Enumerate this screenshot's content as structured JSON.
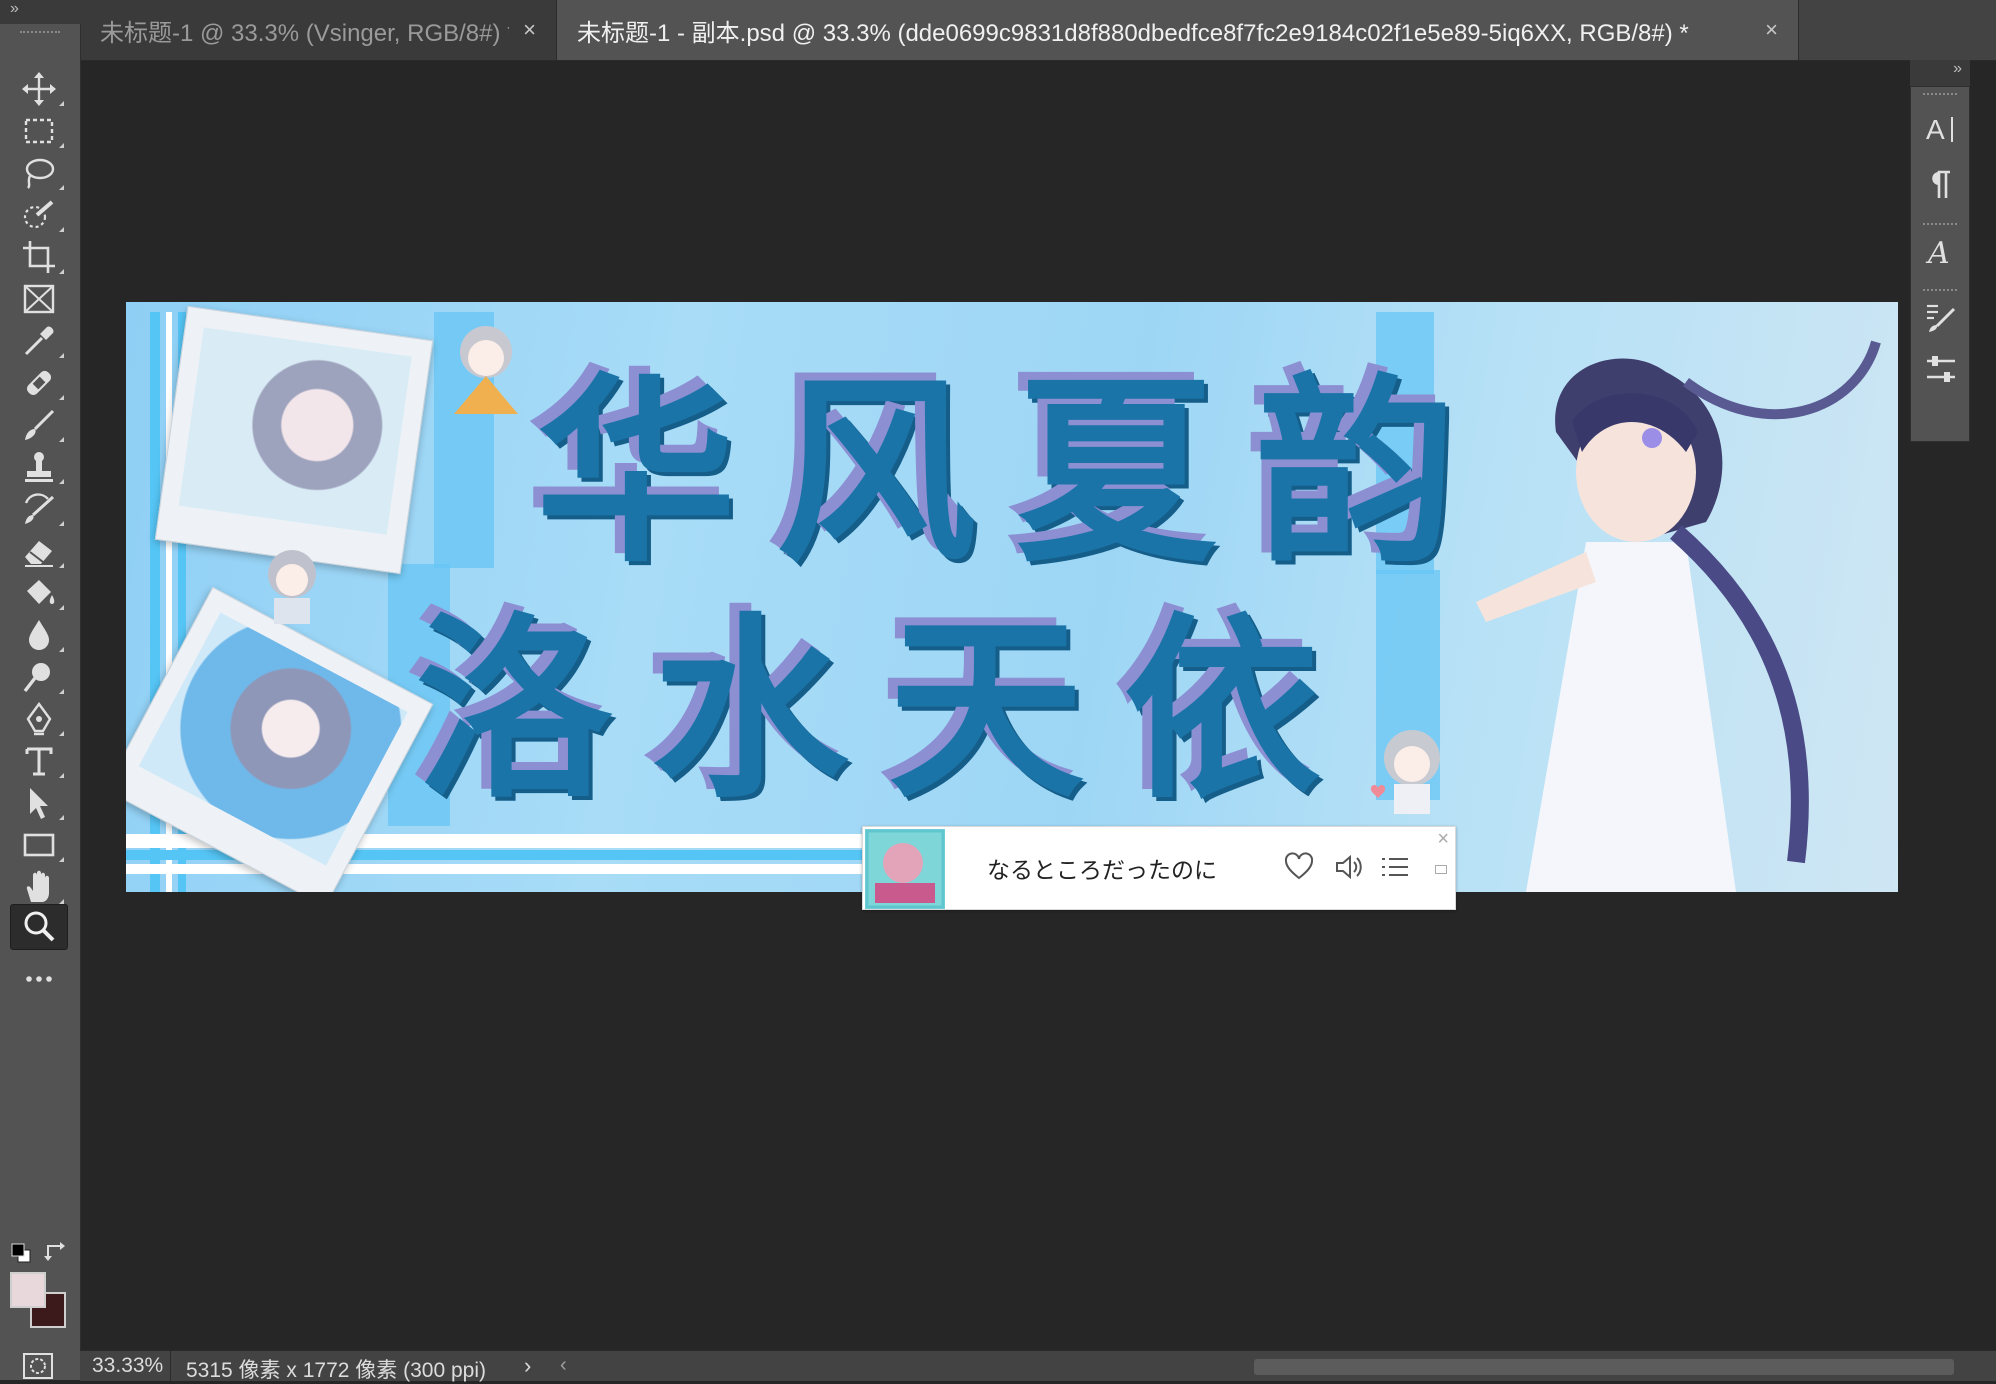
{
  "tabs": [
    {
      "title": "未标题-1 @ 33.3% (Vsinger, RGB/8#) *",
      "close": "×",
      "active": false
    },
    {
      "title": "未标题-1 - 副本.psd @ 33.3% (dde0699c9831d8f880dbedfce8f7fc2e9184c02f1e5e89-5iq6XX, RGB/8#) *",
      "close": "×",
      "active": true
    }
  ],
  "collapse_glyph": "»",
  "tools": [
    {
      "name": "move-tool",
      "icon": "move-icon"
    },
    {
      "name": "marquee-tool",
      "icon": "rect-marquee-icon"
    },
    {
      "name": "lasso-tool",
      "icon": "lasso-icon"
    },
    {
      "name": "quick-select-tool",
      "icon": "quick-select-icon"
    },
    {
      "name": "crop-tool",
      "icon": "crop-icon"
    },
    {
      "name": "frame-tool",
      "icon": "frame-icon"
    },
    {
      "name": "eyedropper-tool",
      "icon": "eyedropper-icon"
    },
    {
      "name": "healing-brush-tool",
      "icon": "bandage-icon"
    },
    {
      "name": "brush-tool",
      "icon": "brush-icon"
    },
    {
      "name": "clone-stamp-tool",
      "icon": "stamp-icon"
    },
    {
      "name": "history-brush-tool",
      "icon": "history-brush-icon"
    },
    {
      "name": "eraser-tool",
      "icon": "eraser-icon"
    },
    {
      "name": "paint-bucket-tool",
      "icon": "bucket-icon"
    },
    {
      "name": "blur-tool",
      "icon": "drop-icon"
    },
    {
      "name": "dodge-tool",
      "icon": "dodge-icon"
    },
    {
      "name": "pen-tool",
      "icon": "pen-icon"
    },
    {
      "name": "type-tool",
      "icon": "type-icon"
    },
    {
      "name": "path-select-tool",
      "icon": "arrow-icon"
    },
    {
      "name": "rectangle-tool",
      "icon": "rectangle-icon"
    },
    {
      "name": "hand-tool",
      "icon": "hand-icon"
    },
    {
      "name": "zoom-tool",
      "icon": "zoom-icon",
      "selected": true
    },
    {
      "name": "more-tools",
      "icon": "ellipsis-icon"
    }
  ],
  "colors": {
    "foreground": "#e8d8dc",
    "background": "#3c1a1c",
    "canvas_bg": "#262626",
    "panel_bg": "#535353"
  },
  "right_panel": [
    "character-panel-icon",
    "paragraph-panel-icon",
    "glyphs-panel-icon",
    "brush-settings-icon",
    "tool-presets-icon"
  ],
  "canvas": {
    "line1": "华风夏韵",
    "line2": "洛水天依"
  },
  "player": {
    "lyric": "なるところだったのに",
    "close": "×",
    "buttons": [
      "heart-icon",
      "volume-icon",
      "playlist-icon"
    ]
  },
  "status": {
    "zoom": "33.33%",
    "doc_info": "5315 像素 x 1772 像素 (300 ppi)",
    "arrow": "›",
    "scroll_left": "‹"
  }
}
